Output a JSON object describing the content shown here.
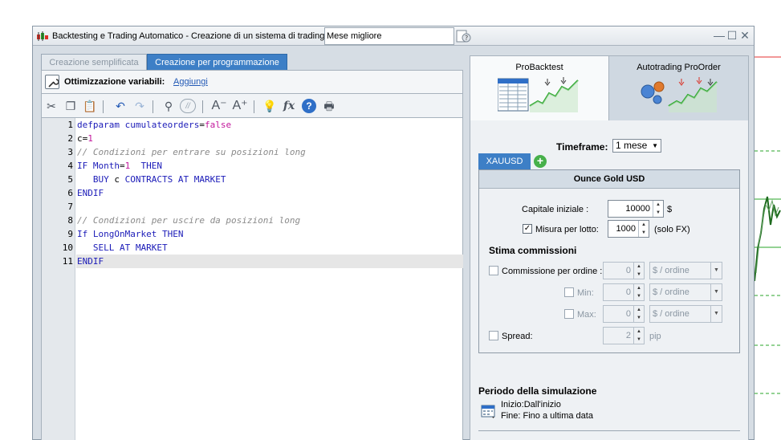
{
  "window": {
    "title": "Backtesting e Trading Automatico - Creazione di un sistema di trading",
    "name_field_value": "Mese migliore",
    "minimize_glyph": "—",
    "maximize_glyph": "☐",
    "close_glyph": "✕"
  },
  "left": {
    "tabs": [
      {
        "label": "Creazione semplificata",
        "active": false
      },
      {
        "label": "Creazione per programmazione",
        "active": true
      }
    ],
    "optimization": {
      "label": "Ottimizzazione variabili:",
      "link": "Aggiungi"
    },
    "toolbar_icons": [
      "cut-icon",
      "copy-icon",
      "paste-icon",
      "undo-icon",
      "redo-icon",
      "search-icon",
      "comment-icon",
      "font-decrease-icon",
      "font-increase-icon",
      "lightbulb-icon",
      "function-icon",
      "help-icon",
      "print-icon"
    ],
    "toolbar_glyphs": {
      "cut": "✂",
      "copy": "❐",
      "paste": "📋",
      "undo": "↶",
      "redo": "↷",
      "search": "⚲",
      "comment": "//",
      "font_decrease": "A⁻",
      "font_increase": "A⁺",
      "lightbulb": "💡",
      "function": "fx",
      "help": "?",
      "print": "🖶"
    },
    "code_lines": [
      {
        "n": "1",
        "text": "defparam cumulateorders=false"
      },
      {
        "n": "2",
        "text": "c=1"
      },
      {
        "n": "3",
        "text": "// Condizioni per entrare su posizioni long"
      },
      {
        "n": "4",
        "text": "IF Month=1  THEN"
      },
      {
        "n": "5",
        "text": "   BUY c CONTRACTS AT MARKET"
      },
      {
        "n": "6",
        "text": "ENDIF"
      },
      {
        "n": "7",
        "text": ""
      },
      {
        "n": "8",
        "text": "// Condizioni per uscire da posizioni long"
      },
      {
        "n": "9",
        "text": "If LongOnMarket THEN"
      },
      {
        "n": "10",
        "text": "   SELL AT MARKET"
      },
      {
        "n": "11",
        "text": "ENDIF"
      }
    ]
  },
  "right": {
    "tabs": [
      {
        "label": "ProBacktest",
        "active": true
      },
      {
        "label": "Autotrading ProOrder",
        "active": false
      }
    ],
    "timeframe_label": "Timeframe:",
    "timeframe_value": "1 mese",
    "instrument_tab": "XAUUSD",
    "instrument_add": "+",
    "instrument_name": "Ounce Gold USD",
    "capital_label": "Capitale iniziale :",
    "capital_value": "10000",
    "capital_unit": "$",
    "lot_label": "Misura per lotto:",
    "lot_checked": true,
    "lot_value": "1000",
    "lot_note": "(solo FX)",
    "commissions_title": "Stima commissioni",
    "commission_order_label": "Commissione per ordine :",
    "commission_order_value": "0",
    "commission_order_unit": "$ / ordine",
    "min_label": "Min:",
    "min_value": "0",
    "min_unit": "$ / ordine",
    "max_label": "Max:",
    "max_value": "0",
    "max_unit": "$ / ordine",
    "spread_label": "Spread:",
    "spread_value": "2",
    "spread_unit": "pip",
    "period_title": "Periodo della simulazione",
    "period_start": "Inizio:Dall'inizio",
    "period_end": "Fine:  Fino a ultima data"
  },
  "colors": {
    "active_tab": "#3d7fc6",
    "keyword": "#1b1bb8",
    "comment": "#8a8a8a",
    "literal": "#c2189c"
  }
}
